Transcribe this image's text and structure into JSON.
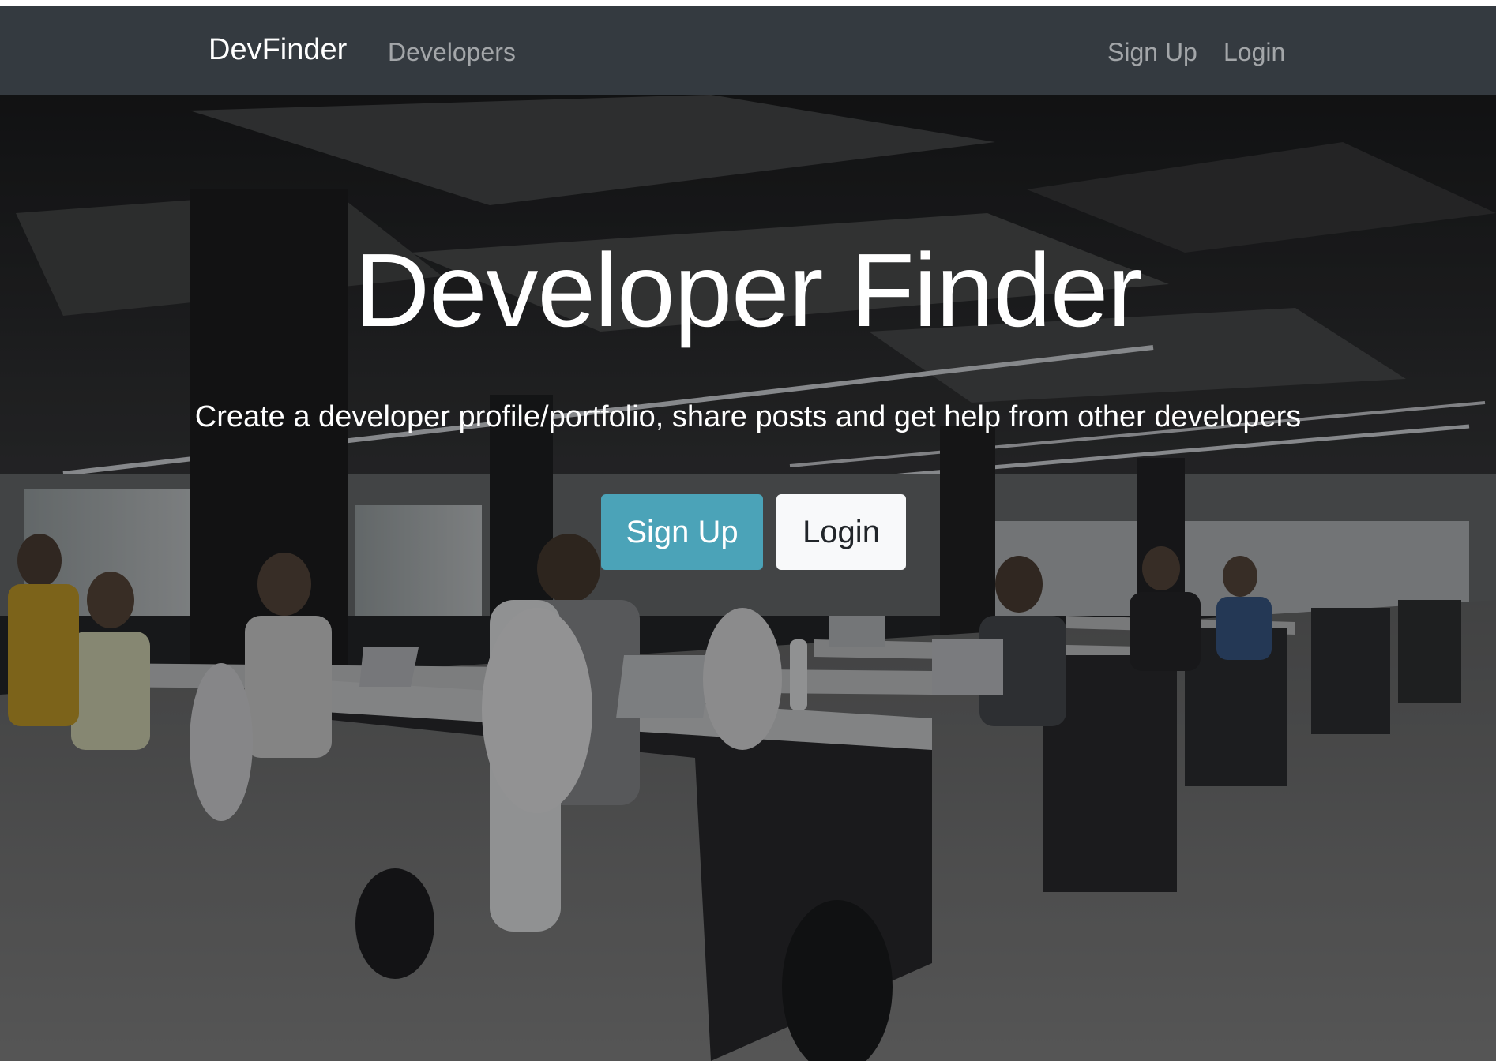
{
  "navbar": {
    "brand": "DevFinder",
    "left_links": [
      {
        "label": "Developers"
      }
    ],
    "right_links": [
      {
        "label": "Sign Up"
      },
      {
        "label": "Login"
      }
    ],
    "background": "#343a40"
  },
  "hero": {
    "title": "Developer Finder",
    "lead": "Create a developer profile/portfolio, share posts and get help from other developers",
    "buttons": {
      "signup_label": "Sign Up",
      "login_label": "Login"
    },
    "background_image": "dimmed photo of an open-plan office with rows of developers at desks",
    "colors": {
      "signup_button": "#4ba3b8",
      "login_button": "#f8f9fa",
      "text": "#ffffff"
    }
  }
}
